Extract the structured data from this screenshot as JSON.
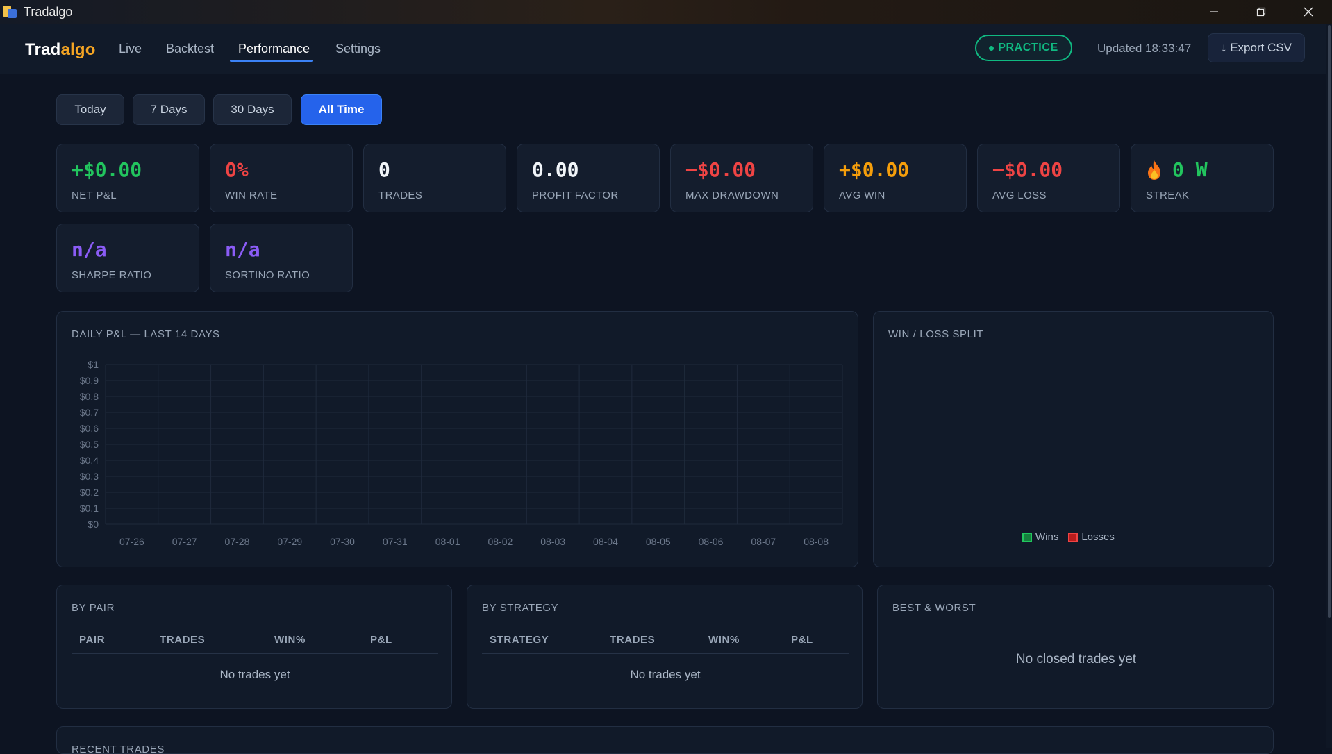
{
  "window": {
    "title": "Tradalgo",
    "controls": [
      "minimize-icon",
      "restore-icon",
      "close-icon"
    ]
  },
  "nav": {
    "brand_part1": "Trad",
    "brand_part2": "algo",
    "tabs": [
      {
        "label": "Live"
      },
      {
        "label": "Backtest"
      },
      {
        "label": "Performance",
        "active": true
      },
      {
        "label": "Settings"
      }
    ],
    "mode_badge": "PRACTICE",
    "updated": "Updated 18:33:47",
    "export_label": "↓ Export CSV"
  },
  "filters": [
    {
      "label": "Today"
    },
    {
      "label": "7 Days"
    },
    {
      "label": "30 Days"
    },
    {
      "label": "All Time",
      "active": true
    }
  ],
  "stats": [
    {
      "value": "+$0.00",
      "label": "NET P&L",
      "color": "#22c55e"
    },
    {
      "value": "0%",
      "label": "WIN RATE",
      "color": "#ef4444"
    },
    {
      "value": "0",
      "label": "TRADES",
      "color": "#f1f5f9"
    },
    {
      "value": "0.00",
      "label": "PROFIT FACTOR",
      "color": "#f1f5f9"
    },
    {
      "value": "−$0.00",
      "label": "MAX DRAWDOWN",
      "color": "#ef4444"
    },
    {
      "value": "+$0.00",
      "label": "AVG WIN",
      "color": "#f59e0b"
    },
    {
      "value": "−$0.00",
      "label": "AVG LOSS",
      "color": "#ef4444"
    },
    {
      "value": "0 W",
      "label": "STREAK",
      "color": "#22c55e",
      "icon": "flame-icon"
    },
    {
      "value": "n/a",
      "label": "SHARPE RATIO",
      "color": "#8b5cf6"
    },
    {
      "value": "n/a",
      "label": "SORTINO RATIO",
      "color": "#8b5cf6"
    }
  ],
  "daily_chart": {
    "title": "DAILY P&L — LAST 14 DAYS"
  },
  "chart_data": {
    "type": "bar",
    "categories": [
      "07-26",
      "07-27",
      "07-28",
      "07-29",
      "07-30",
      "07-31",
      "08-01",
      "08-02",
      "08-03",
      "08-04",
      "08-05",
      "08-06",
      "08-07",
      "08-08"
    ],
    "values": [
      0,
      0,
      0,
      0,
      0,
      0,
      0,
      0,
      0,
      0,
      0,
      0,
      0,
      0
    ],
    "ylim": [
      0,
      1
    ],
    "yticks": [
      "$0",
      "$0.1",
      "$0.2",
      "$0.3",
      "$0.4",
      "$0.5",
      "$0.6",
      "$0.7",
      "$0.8",
      "$0.9",
      "$1"
    ],
    "grid": true
  },
  "winloss": {
    "title": "WIN / LOSS SPLIT",
    "legend": [
      {
        "label": "Wins",
        "color": "#22c55e"
      },
      {
        "label": "Losses",
        "color": "#ef4444"
      }
    ]
  },
  "by_pair": {
    "title": "BY PAIR",
    "columns": [
      "PAIR",
      "TRADES",
      "WIN%",
      "P&L"
    ],
    "empty": "No trades yet"
  },
  "by_strategy": {
    "title": "BY STRATEGY",
    "columns": [
      "STRATEGY",
      "TRADES",
      "WIN%",
      "P&L"
    ],
    "empty": "No trades yet"
  },
  "best_worst": {
    "title": "BEST & WORST",
    "empty": "No closed trades yet"
  },
  "recent": {
    "title": "RECENT TRADES"
  }
}
